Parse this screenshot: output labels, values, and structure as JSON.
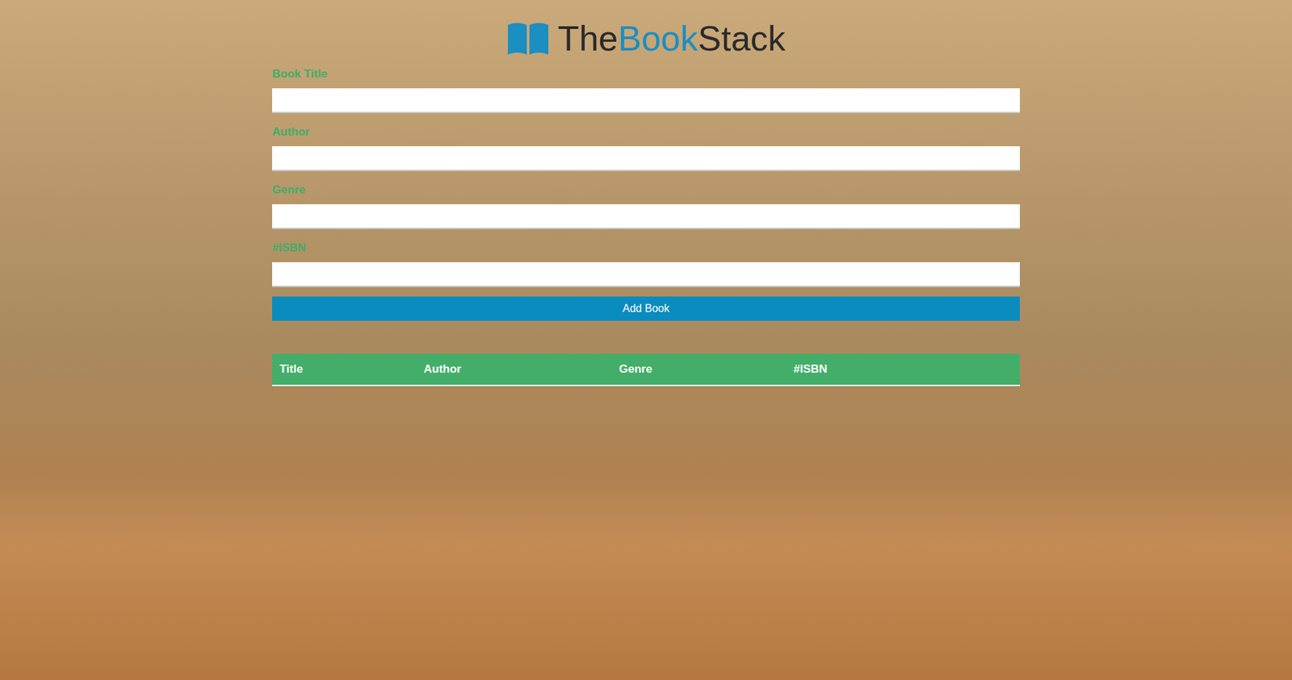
{
  "logo": {
    "parts": [
      "The",
      "Book",
      "Stack"
    ]
  },
  "form": {
    "fields": [
      {
        "label": "Book Title",
        "value": ""
      },
      {
        "label": "Author",
        "value": ""
      },
      {
        "label": "Genre",
        "value": ""
      },
      {
        "label": "#ISBN",
        "value": ""
      }
    ],
    "button": "Add Book"
  },
  "table": {
    "columns": [
      "Title",
      "Author",
      "Genre",
      "#ISBN"
    ],
    "rows": []
  }
}
